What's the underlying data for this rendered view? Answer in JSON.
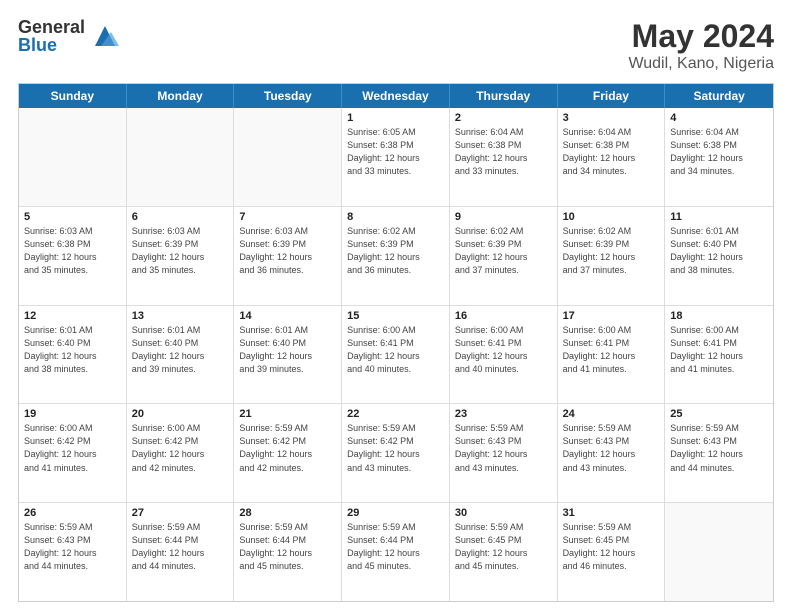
{
  "logo": {
    "general": "General",
    "blue": "Blue"
  },
  "title": {
    "month_year": "May 2024",
    "location": "Wudil, Kano, Nigeria"
  },
  "header_days": [
    "Sunday",
    "Monday",
    "Tuesday",
    "Wednesday",
    "Thursday",
    "Friday",
    "Saturday"
  ],
  "weeks": [
    [
      {
        "day": "",
        "info": ""
      },
      {
        "day": "",
        "info": ""
      },
      {
        "day": "",
        "info": ""
      },
      {
        "day": "1",
        "info": "Sunrise: 6:05 AM\nSunset: 6:38 PM\nDaylight: 12 hours\nand 33 minutes."
      },
      {
        "day": "2",
        "info": "Sunrise: 6:04 AM\nSunset: 6:38 PM\nDaylight: 12 hours\nand 33 minutes."
      },
      {
        "day": "3",
        "info": "Sunrise: 6:04 AM\nSunset: 6:38 PM\nDaylight: 12 hours\nand 34 minutes."
      },
      {
        "day": "4",
        "info": "Sunrise: 6:04 AM\nSunset: 6:38 PM\nDaylight: 12 hours\nand 34 minutes."
      }
    ],
    [
      {
        "day": "5",
        "info": "Sunrise: 6:03 AM\nSunset: 6:38 PM\nDaylight: 12 hours\nand 35 minutes."
      },
      {
        "day": "6",
        "info": "Sunrise: 6:03 AM\nSunset: 6:39 PM\nDaylight: 12 hours\nand 35 minutes."
      },
      {
        "day": "7",
        "info": "Sunrise: 6:03 AM\nSunset: 6:39 PM\nDaylight: 12 hours\nand 36 minutes."
      },
      {
        "day": "8",
        "info": "Sunrise: 6:02 AM\nSunset: 6:39 PM\nDaylight: 12 hours\nand 36 minutes."
      },
      {
        "day": "9",
        "info": "Sunrise: 6:02 AM\nSunset: 6:39 PM\nDaylight: 12 hours\nand 37 minutes."
      },
      {
        "day": "10",
        "info": "Sunrise: 6:02 AM\nSunset: 6:39 PM\nDaylight: 12 hours\nand 37 minutes."
      },
      {
        "day": "11",
        "info": "Sunrise: 6:01 AM\nSunset: 6:40 PM\nDaylight: 12 hours\nand 38 minutes."
      }
    ],
    [
      {
        "day": "12",
        "info": "Sunrise: 6:01 AM\nSunset: 6:40 PM\nDaylight: 12 hours\nand 38 minutes."
      },
      {
        "day": "13",
        "info": "Sunrise: 6:01 AM\nSunset: 6:40 PM\nDaylight: 12 hours\nand 39 minutes."
      },
      {
        "day": "14",
        "info": "Sunrise: 6:01 AM\nSunset: 6:40 PM\nDaylight: 12 hours\nand 39 minutes."
      },
      {
        "day": "15",
        "info": "Sunrise: 6:00 AM\nSunset: 6:41 PM\nDaylight: 12 hours\nand 40 minutes."
      },
      {
        "day": "16",
        "info": "Sunrise: 6:00 AM\nSunset: 6:41 PM\nDaylight: 12 hours\nand 40 minutes."
      },
      {
        "day": "17",
        "info": "Sunrise: 6:00 AM\nSunset: 6:41 PM\nDaylight: 12 hours\nand 41 minutes."
      },
      {
        "day": "18",
        "info": "Sunrise: 6:00 AM\nSunset: 6:41 PM\nDaylight: 12 hours\nand 41 minutes."
      }
    ],
    [
      {
        "day": "19",
        "info": "Sunrise: 6:00 AM\nSunset: 6:42 PM\nDaylight: 12 hours\nand 41 minutes."
      },
      {
        "day": "20",
        "info": "Sunrise: 6:00 AM\nSunset: 6:42 PM\nDaylight: 12 hours\nand 42 minutes."
      },
      {
        "day": "21",
        "info": "Sunrise: 5:59 AM\nSunset: 6:42 PM\nDaylight: 12 hours\nand 42 minutes."
      },
      {
        "day": "22",
        "info": "Sunrise: 5:59 AM\nSunset: 6:42 PM\nDaylight: 12 hours\nand 43 minutes."
      },
      {
        "day": "23",
        "info": "Sunrise: 5:59 AM\nSunset: 6:43 PM\nDaylight: 12 hours\nand 43 minutes."
      },
      {
        "day": "24",
        "info": "Sunrise: 5:59 AM\nSunset: 6:43 PM\nDaylight: 12 hours\nand 43 minutes."
      },
      {
        "day": "25",
        "info": "Sunrise: 5:59 AM\nSunset: 6:43 PM\nDaylight: 12 hours\nand 44 minutes."
      }
    ],
    [
      {
        "day": "26",
        "info": "Sunrise: 5:59 AM\nSunset: 6:43 PM\nDaylight: 12 hours\nand 44 minutes."
      },
      {
        "day": "27",
        "info": "Sunrise: 5:59 AM\nSunset: 6:44 PM\nDaylight: 12 hours\nand 44 minutes."
      },
      {
        "day": "28",
        "info": "Sunrise: 5:59 AM\nSunset: 6:44 PM\nDaylight: 12 hours\nand 45 minutes."
      },
      {
        "day": "29",
        "info": "Sunrise: 5:59 AM\nSunset: 6:44 PM\nDaylight: 12 hours\nand 45 minutes."
      },
      {
        "day": "30",
        "info": "Sunrise: 5:59 AM\nSunset: 6:45 PM\nDaylight: 12 hours\nand 45 minutes."
      },
      {
        "day": "31",
        "info": "Sunrise: 5:59 AM\nSunset: 6:45 PM\nDaylight: 12 hours\nand 46 minutes."
      },
      {
        "day": "",
        "info": ""
      }
    ]
  ]
}
